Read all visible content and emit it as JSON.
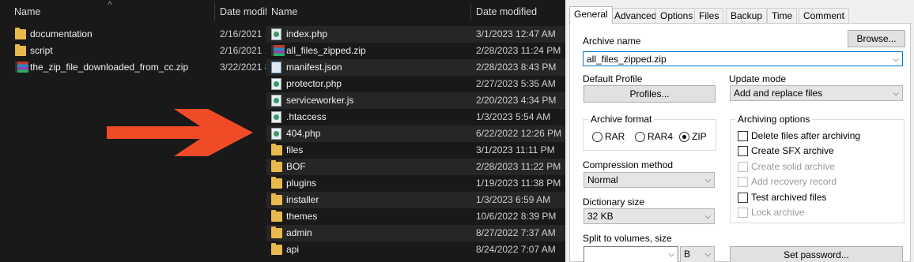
{
  "left_explorer": {
    "columns": {
      "name": "Name",
      "date": "Date modif"
    },
    "rows": [
      {
        "name": "documentation",
        "date": "2/16/2021 1",
        "icon": "folder-icon"
      },
      {
        "name": "script",
        "date": "2/16/2021 1",
        "icon": "folder-icon"
      },
      {
        "name": "the_zip_file_downloaded_from_cc.zip",
        "date": "3/22/2021 8",
        "icon": "winrar-archive-icon"
      }
    ]
  },
  "middle_explorer": {
    "columns": {
      "name": "Name",
      "date": "Date modified"
    },
    "rows": [
      {
        "name": "index.php",
        "date": "3/1/2023 12:47 AM",
        "icon": "php-file-icon"
      },
      {
        "name": "all_files_zipped.zip",
        "date": "2/28/2023 11:24 PM",
        "icon": "winrar-archive-icon"
      },
      {
        "name": "manifest.json",
        "date": "2/28/2023 8:43 PM",
        "icon": "json-file-icon"
      },
      {
        "name": "protector.php",
        "date": "2/27/2023 5:35 AM",
        "icon": "php-file-icon"
      },
      {
        "name": "serviceworker.js",
        "date": "2/20/2023 4:34 PM",
        "icon": "js-file-icon"
      },
      {
        "name": ".htaccess",
        "date": "1/3/2023 5:54 AM",
        "icon": "php-file-icon"
      },
      {
        "name": "404.php",
        "date": "6/22/2022 12:26 PM",
        "icon": "php-file-icon"
      },
      {
        "name": "files",
        "date": "3/1/2023 11:11 PM",
        "icon": "folder-icon"
      },
      {
        "name": "BOF",
        "date": "2/28/2023 11:22 PM",
        "icon": "folder-icon"
      },
      {
        "name": "plugins",
        "date": "1/19/2023 11:38 PM",
        "icon": "folder-icon"
      },
      {
        "name": "installer",
        "date": "1/3/2023 6:59 AM",
        "icon": "folder-icon"
      },
      {
        "name": "themes",
        "date": "10/6/2022 8:39 PM",
        "icon": "folder-icon"
      },
      {
        "name": "admin",
        "date": "8/27/2022 7:37 AM",
        "icon": "folder-icon"
      },
      {
        "name": "api",
        "date": "8/24/2022 7:07 AM",
        "icon": "folder-icon"
      }
    ]
  },
  "arrow": {
    "icon": "right-arrow-icon",
    "color": "#f04a26"
  },
  "archive_dialog": {
    "tabs": [
      "General",
      "Advanced",
      "Options",
      "Files",
      "Backup",
      "Time",
      "Comment"
    ],
    "active_tab": "General",
    "archive_name_label": "Archive name",
    "archive_name_value": "all_files_zipped.zip",
    "browse_label": "Browse...",
    "default_profile_label": "Default Profile",
    "profiles_label": "Profiles...",
    "update_mode_label": "Update mode",
    "update_mode_value": "Add and replace files",
    "archive_format_label": "Archive format",
    "formats": [
      {
        "label": "RAR",
        "selected": false
      },
      {
        "label": "RAR4",
        "selected": false
      },
      {
        "label": "ZIP",
        "selected": true
      }
    ],
    "archiving_options_label": "Archiving options",
    "options": [
      {
        "label": "Delete files after archiving",
        "checked": false,
        "enabled": true
      },
      {
        "label": "Create SFX archive",
        "checked": false,
        "enabled": true
      },
      {
        "label": "Create solid archive",
        "checked": false,
        "enabled": false
      },
      {
        "label": "Add recovery record",
        "checked": false,
        "enabled": false
      },
      {
        "label": "Test archived files",
        "checked": false,
        "enabled": true
      },
      {
        "label": "Lock archive",
        "checked": false,
        "enabled": false
      }
    ],
    "compression_method_label": "Compression method",
    "compression_method_value": "Normal",
    "dictionary_size_label": "Dictionary size",
    "dictionary_size_value": "32 KB",
    "split_label": "Split to volumes, size",
    "split_value": "",
    "split_unit": "B",
    "set_password_label": "Set password..."
  }
}
